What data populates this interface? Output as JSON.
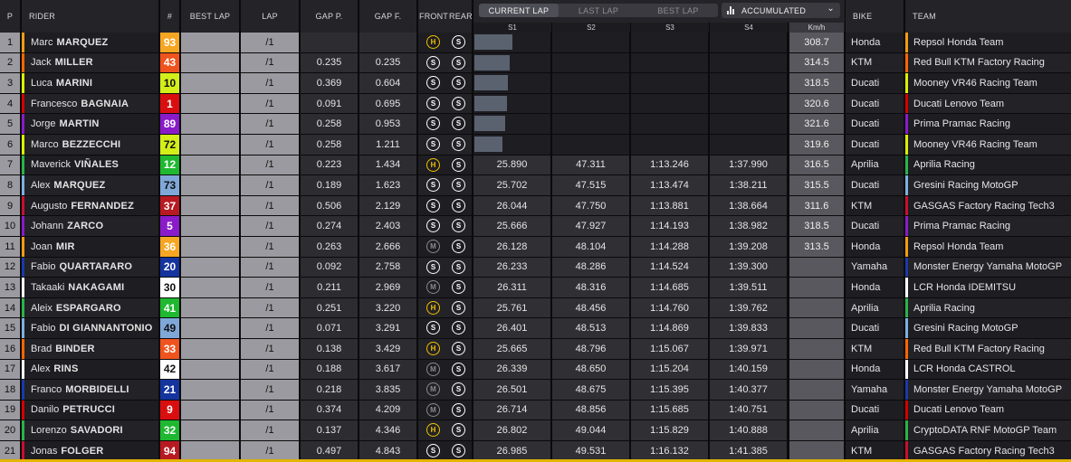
{
  "headers": {
    "pos": "P",
    "rider": "RIDER",
    "number": "#",
    "best_lap": "BEST LAP",
    "lap": "LAP",
    "gap_p": "GAP P.",
    "gap_f": "GAP F.",
    "front": "FRONT",
    "rear": "REAR",
    "s1": "S1",
    "s2": "S2",
    "s3": "S3",
    "s4": "S4",
    "kmh": "Km/h",
    "bike": "BIKE",
    "team": "TEAM"
  },
  "sector_tabs": {
    "current_lap": "CURRENT LAP",
    "last_lap": "LAST LAP",
    "best_lap": "BEST LAP",
    "active": "current_lap"
  },
  "accumulated_select": {
    "value": "ACCUMULATED",
    "icon": "bar-chart-icon"
  },
  "rows": [
    {
      "pos": "1",
      "first": "Marc",
      "last": "MARQUEZ",
      "num": "93",
      "num_bg": "#f5a623",
      "num_fg": "#ffffff",
      "lap": "/1",
      "gap_p": "",
      "gap_f": "",
      "front": "H",
      "rear": "S",
      "progress": 0.5,
      "s1": "",
      "s2": "",
      "s3": "",
      "s4": "",
      "kmh": "308.7",
      "bike": "Honda",
      "team": "Repsol Honda Team",
      "team_color": "#f39c12"
    },
    {
      "pos": "2",
      "first": "Jack",
      "last": "MILLER",
      "num": "43",
      "num_bg": "#f0541e",
      "num_fg": "#ffffff",
      "lap": "/1",
      "gap_p": "0.235",
      "gap_f": "0.235",
      "front": "S",
      "rear": "S",
      "progress": 0.47,
      "s1": "",
      "s2": "",
      "s3": "",
      "s4": "",
      "kmh": "314.5",
      "bike": "KTM",
      "team": "Red Bull KTM Factory Racing",
      "team_color": "#ff6600"
    },
    {
      "pos": "3",
      "first": "Luca",
      "last": "MARINI",
      "num": "10",
      "num_bg": "#d4ee1a",
      "num_fg": "#111111",
      "lap": "/1",
      "gap_p": "0.369",
      "gap_f": "0.604",
      "front": "S",
      "rear": "S",
      "progress": 0.44,
      "s1": "",
      "s2": "",
      "s3": "",
      "s4": "",
      "kmh": "318.5",
      "bike": "Ducati",
      "team": "Mooney VR46 Racing Team",
      "team_color": "#d9f000"
    },
    {
      "pos": "4",
      "first": "Francesco",
      "last": "BAGNAIA",
      "num": "1",
      "num_bg": "#d90f0f",
      "num_fg": "#ffffff",
      "lap": "/1",
      "gap_p": "0.091",
      "gap_f": "0.695",
      "front": "S",
      "rear": "S",
      "progress": 0.43,
      "s1": "",
      "s2": "",
      "s3": "",
      "s4": "",
      "kmh": "320.6",
      "bike": "Ducati",
      "team": "Ducati Lenovo Team",
      "team_color": "#d40000"
    },
    {
      "pos": "5",
      "first": "Jorge",
      "last": "MARTIN",
      "num": "89",
      "num_bg": "#8a1bc9",
      "num_fg": "#ffffff",
      "lap": "/1",
      "gap_p": "0.258",
      "gap_f": "0.953",
      "front": "S",
      "rear": "S",
      "progress": 0.41,
      "s1": "",
      "s2": "",
      "s3": "",
      "s4": "",
      "kmh": "321.6",
      "bike": "Ducati",
      "team": "Prima Pramac Racing",
      "team_color": "#8a1bc9"
    },
    {
      "pos": "6",
      "first": "Marco",
      "last": "BEZZECCHI",
      "num": "72",
      "num_bg": "#d4ee1a",
      "num_fg": "#111111",
      "lap": "/1",
      "gap_p": "0.258",
      "gap_f": "1.211",
      "front": "S",
      "rear": "S",
      "progress": 0.37,
      "s1": "",
      "s2": "",
      "s3": "",
      "s4": "",
      "kmh": "319.6",
      "bike": "Ducati",
      "team": "Mooney VR46 Racing Team",
      "team_color": "#d9f000"
    },
    {
      "pos": "7",
      "first": "Maverick",
      "last": "VIÑALES",
      "num": "12",
      "num_bg": "#1fb830",
      "num_fg": "#ffffff",
      "lap": "/1",
      "gap_p": "0.223",
      "gap_f": "1.434",
      "front": "H",
      "rear": "S",
      "progress": 0,
      "s1": "25.890",
      "s2": "47.311",
      "s3": "1:13.246",
      "s4": "1:37.990",
      "kmh": "316.5",
      "bike": "Aprilia",
      "team": "Aprilia Racing",
      "team_color": "#2bb34a"
    },
    {
      "pos": "8",
      "first": "Alex",
      "last": "MARQUEZ",
      "num": "73",
      "num_bg": "#7fa8d8",
      "num_fg": "#111111",
      "lap": "/1",
      "gap_p": "0.189",
      "gap_f": "1.623",
      "front": "S",
      "rear": "S",
      "progress": 0,
      "s1": "25.702",
      "s2": "47.515",
      "s3": "1:13.474",
      "s4": "1:38.211",
      "kmh": "315.5",
      "bike": "Ducati",
      "team": "Gresini Racing MotoGP",
      "team_color": "#7fb0e0"
    },
    {
      "pos": "9",
      "first": "Augusto",
      "last": "FERNANDEZ",
      "num": "37",
      "num_bg": "#b81a22",
      "num_fg": "#ffffff",
      "lap": "/1",
      "gap_p": "0.506",
      "gap_f": "2.129",
      "front": "S",
      "rear": "S",
      "progress": 0,
      "s1": "26.044",
      "s2": "47.750",
      "s3": "1:13.881",
      "s4": "1:38.664",
      "kmh": "311.6",
      "bike": "KTM",
      "team": "GASGAS Factory Racing Tech3",
      "team_color": "#c8102e"
    },
    {
      "pos": "10",
      "first": "Johann",
      "last": "ZARCO",
      "num": "5",
      "num_bg": "#8a1bc9",
      "num_fg": "#ffffff",
      "lap": "/1",
      "gap_p": "0.274",
      "gap_f": "2.403",
      "front": "S",
      "rear": "S",
      "progress": 0,
      "s1": "25.666",
      "s2": "47.927",
      "s3": "1:14.193",
      "s4": "1:38.982",
      "kmh": "318.5",
      "bike": "Ducati",
      "team": "Prima Pramac Racing",
      "team_color": "#8a1bc9"
    },
    {
      "pos": "11",
      "first": "Joan",
      "last": "MIR",
      "num": "36",
      "num_bg": "#f5a623",
      "num_fg": "#ffffff",
      "lap": "/1",
      "gap_p": "0.263",
      "gap_f": "2.666",
      "front": "M",
      "rear": "S",
      "progress": 0,
      "s1": "26.128",
      "s2": "48.104",
      "s3": "1:14.288",
      "s4": "1:39.208",
      "kmh": "313.5",
      "bike": "Honda",
      "team": "Repsol Honda Team",
      "team_color": "#f39c12"
    },
    {
      "pos": "12",
      "first": "Fabio",
      "last": "QUARTARARO",
      "num": "20",
      "num_bg": "#15349e",
      "num_fg": "#ffffff",
      "lap": "/1",
      "gap_p": "0.092",
      "gap_f": "2.758",
      "front": "S",
      "rear": "S",
      "progress": 0,
      "s1": "26.233",
      "s2": "48.286",
      "s3": "1:14.524",
      "s4": "1:39.300",
      "kmh": "",
      "bike": "Yamaha",
      "team": "Monster Energy Yamaha MotoGP",
      "team_color": "#1a3aa8"
    },
    {
      "pos": "13",
      "first": "Takaaki",
      "last": "NAKAGAMI",
      "num": "30",
      "num_bg": "#ffffff",
      "num_fg": "#111111",
      "lap": "/1",
      "gap_p": "0.211",
      "gap_f": "2.969",
      "front": "M",
      "rear": "S",
      "progress": 0,
      "s1": "26.311",
      "s2": "48.316",
      "s3": "1:14.685",
      "s4": "1:39.511",
      "kmh": "",
      "bike": "Honda",
      "team": "LCR Honda IDEMITSU",
      "team_color": "#ffffff"
    },
    {
      "pos": "14",
      "first": "Aleix",
      "last": "ESPARGARO",
      "num": "41",
      "num_bg": "#1fb830",
      "num_fg": "#ffffff",
      "lap": "/1",
      "gap_p": "0.251",
      "gap_f": "3.220",
      "front": "H",
      "rear": "S",
      "progress": 0,
      "s1": "25.761",
      "s2": "48.456",
      "s3": "1:14.760",
      "s4": "1:39.762",
      "kmh": "",
      "bike": "Aprilia",
      "team": "Aprilia Racing",
      "team_color": "#2bb34a"
    },
    {
      "pos": "15",
      "first": "Fabio",
      "last": "DI GIANNANTONIO",
      "num": "49",
      "num_bg": "#7fa8d8",
      "num_fg": "#111111",
      "lap": "/1",
      "gap_p": "0.071",
      "gap_f": "3.291",
      "front": "S",
      "rear": "S",
      "progress": 0,
      "s1": "26.401",
      "s2": "48.513",
      "s3": "1:14.869",
      "s4": "1:39.833",
      "kmh": "",
      "bike": "Ducati",
      "team": "Gresini Racing MotoGP",
      "team_color": "#7fb0e0"
    },
    {
      "pos": "16",
      "first": "Brad",
      "last": "BINDER",
      "num": "33",
      "num_bg": "#f0541e",
      "num_fg": "#ffffff",
      "lap": "/1",
      "gap_p": "0.138",
      "gap_f": "3.429",
      "front": "H",
      "rear": "S",
      "progress": 0,
      "s1": "25.665",
      "s2": "48.796",
      "s3": "1:15.067",
      "s4": "1:39.971",
      "kmh": "",
      "bike": "KTM",
      "team": "Red Bull KTM Factory Racing",
      "team_color": "#ff6600"
    },
    {
      "pos": "17",
      "first": "Alex",
      "last": "RINS",
      "num": "42",
      "num_bg": "#ffffff",
      "num_fg": "#111111",
      "lap": "/1",
      "gap_p": "0.188",
      "gap_f": "3.617",
      "front": "M",
      "rear": "S",
      "progress": 0,
      "s1": "26.339",
      "s2": "48.650",
      "s3": "1:15.204",
      "s4": "1:40.159",
      "kmh": "",
      "bike": "Honda",
      "team": "LCR Honda CASTROL",
      "team_color": "#ffffff"
    },
    {
      "pos": "18",
      "first": "Franco",
      "last": "MORBIDELLI",
      "num": "21",
      "num_bg": "#15349e",
      "num_fg": "#ffffff",
      "lap": "/1",
      "gap_p": "0.218",
      "gap_f": "3.835",
      "front": "M",
      "rear": "S",
      "progress": 0,
      "s1": "26.501",
      "s2": "48.675",
      "s3": "1:15.395",
      "s4": "1:40.377",
      "kmh": "",
      "bike": "Yamaha",
      "team": "Monster Energy Yamaha MotoGP",
      "team_color": "#1a3aa8"
    },
    {
      "pos": "19",
      "first": "Danilo",
      "last": "PETRUCCI",
      "num": "9",
      "num_bg": "#d90f0f",
      "num_fg": "#ffffff",
      "lap": "/1",
      "gap_p": "0.374",
      "gap_f": "4.209",
      "front": "M",
      "rear": "S",
      "progress": 0,
      "s1": "26.714",
      "s2": "48.856",
      "s3": "1:15.685",
      "s4": "1:40.751",
      "kmh": "",
      "bike": "Ducati",
      "team": "Ducati Lenovo Team",
      "team_color": "#d40000"
    },
    {
      "pos": "20",
      "first": "Lorenzo",
      "last": "SAVADORI",
      "num": "32",
      "num_bg": "#1fb830",
      "num_fg": "#ffffff",
      "lap": "/1",
      "gap_p": "0.137",
      "gap_f": "4.346",
      "front": "H",
      "rear": "S",
      "progress": 0,
      "s1": "26.802",
      "s2": "49.044",
      "s3": "1:15.829",
      "s4": "1:40.888",
      "kmh": "",
      "bike": "Aprilia",
      "team": "CryptoDATA RNF MotoGP Team",
      "team_color": "#2bb34a"
    },
    {
      "pos": "21",
      "first": "Jonas",
      "last": "FOLGER",
      "num": "94",
      "num_bg": "#b81a22",
      "num_fg": "#ffffff",
      "lap": "/1",
      "gap_p": "0.497",
      "gap_f": "4.843",
      "front": "S",
      "rear": "S",
      "progress": 0,
      "s1": "26.985",
      "s2": "49.531",
      "s3": "1:16.132",
      "s4": "1:41.385",
      "kmh": "",
      "bike": "KTM",
      "team": "GASGAS Factory Racing Tech3",
      "team_color": "#c8102e"
    }
  ]
}
